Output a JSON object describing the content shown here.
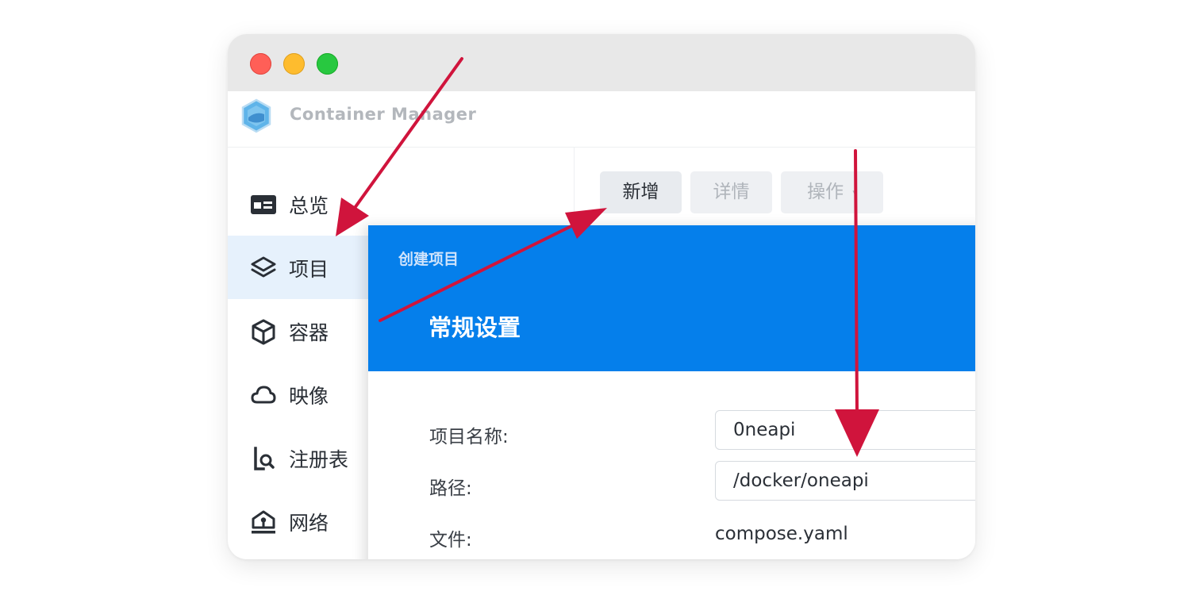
{
  "app": {
    "title": "Container Manager"
  },
  "toolbar": {
    "add_label": "新增",
    "detail_label": "详情",
    "action_label": "操作"
  },
  "sidebar": {
    "items": [
      {
        "label": "总览",
        "icon": "overview-icon",
        "active": false
      },
      {
        "label": "项目",
        "icon": "layers-icon",
        "active": true
      },
      {
        "label": "容器",
        "icon": "container-box-icon",
        "active": false
      },
      {
        "label": "映像",
        "icon": "cloud-icon",
        "active": false
      },
      {
        "label": "注册表",
        "icon": "registry-search-icon",
        "active": false
      },
      {
        "label": "网络",
        "icon": "network-icon",
        "active": false
      }
    ]
  },
  "dialog": {
    "caption": "创建项目",
    "title": "常规设置",
    "fields": {
      "name_label": "项目名称:",
      "name_value": "0neapi",
      "path_label": "路径:",
      "path_value": "/docker/oneapi",
      "file_label": "文件:",
      "file_value": "compose.yaml"
    }
  },
  "colors": {
    "accent": "#057feb",
    "active_nav_bg": "#e6f1fc",
    "annotation_arrow": "#d0143c",
    "traffic_red": "#ff5f57",
    "traffic_yellow": "#febc2e",
    "traffic_green": "#28c840"
  }
}
